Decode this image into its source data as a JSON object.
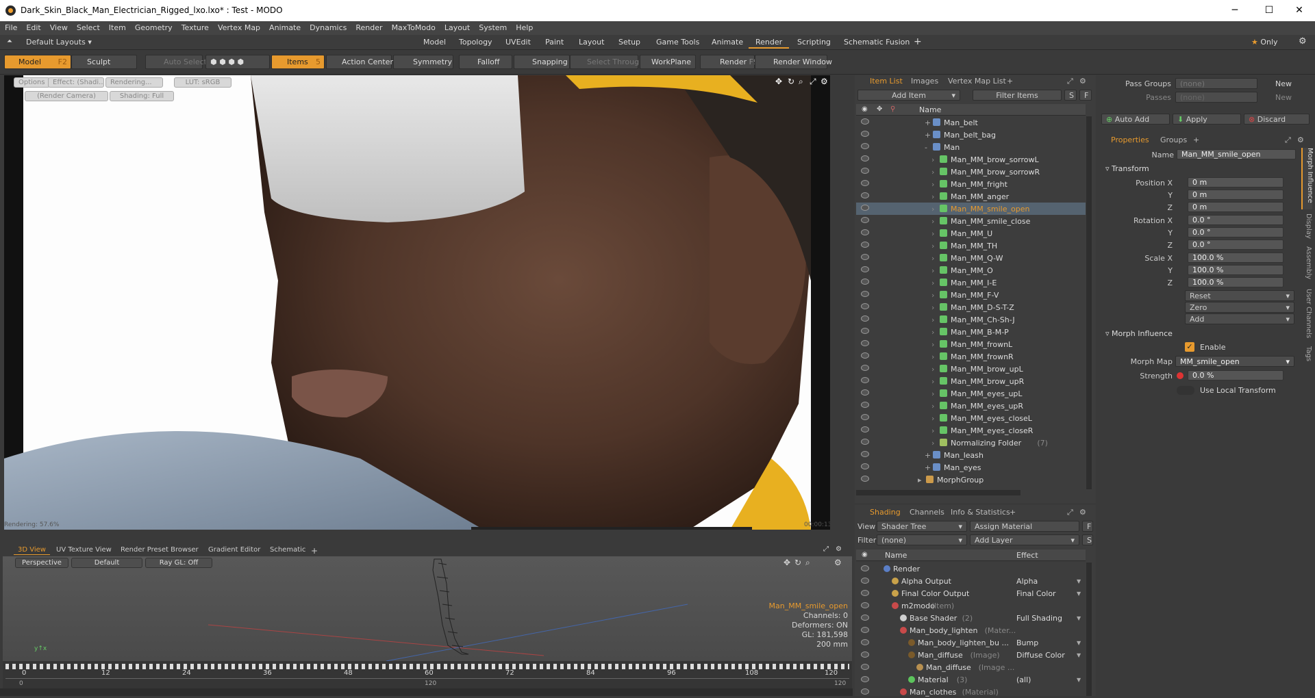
{
  "app": {
    "title": "Dark_Skin_Black_Man_Electrician_Rigged_lxo.lxo* : Test - MODO"
  },
  "menu": [
    "File",
    "Edit",
    "View",
    "Select",
    "Item",
    "Geometry",
    "Texture",
    "Vertex Map",
    "Animate",
    "Dynamics",
    "Render",
    "MaxToModo",
    "Layout",
    "System",
    "Help"
  ],
  "layoutbar": {
    "preset": "Default Layouts",
    "tabs": [
      "Model",
      "Topology",
      "UVEdit",
      "Paint",
      "Layout",
      "Setup",
      "Game Tools",
      "Animate",
      "Render",
      "Scripting",
      "Schematic Fusion"
    ],
    "active": "Render",
    "only": "Only"
  },
  "toolbar": {
    "model": "Model",
    "model_key": "F2",
    "sculpt": "Sculpt",
    "auto_select": "Auto Select",
    "items": "Items",
    "items_key": "5",
    "action_center": "Action Center",
    "symmetry": "Symmetry",
    "falloff": "Falloff",
    "snapping": "Snapping",
    "select_through": "Select Through",
    "workplane": "WorkPlane",
    "render": "Render",
    "render_key": "F9",
    "render_window": "Render Window"
  },
  "viewport": {
    "options": "Options",
    "effect": "Effect: (Shadi...",
    "rendering": "Rendering...",
    "lut": "LUT: sRGB",
    "camera": "(Render Camera)",
    "shading": "Shading: Full",
    "render_status": "Rendering: 57.6%",
    "time": "00:00:13"
  },
  "bottom_tabs": [
    "3D View",
    "UV Texture View",
    "Render Preset Browser",
    "Gradient Editor",
    "Schematic"
  ],
  "view3d": {
    "perspective": "Perspective",
    "default": "Default",
    "raygl": "Ray GL: Off",
    "item": "Man_MM_smile_open",
    "channels": "Channels: 0",
    "deformers": "Deformers: ON",
    "gl": "GL: 181,598",
    "scale": "200 mm"
  },
  "timeline": {
    "ticks": [
      "0",
      "12",
      "24",
      "36",
      "48",
      "60",
      "72",
      "84",
      "96",
      "108",
      "120"
    ],
    "lower": [
      "0",
      "120",
      "120"
    ]
  },
  "item_list": {
    "tabs": [
      "Item List",
      "Images",
      "Vertex Map List"
    ],
    "add_item": "Add Item",
    "filter": "Filter Items",
    "col_name": "Name",
    "rows": [
      {
        "label": "Man_belt",
        "indent": 2,
        "kind": "mesh",
        "exp": "+"
      },
      {
        "label": "Man_belt_bag",
        "indent": 2,
        "kind": "mesh",
        "exp": "+"
      },
      {
        "label": "Man",
        "indent": 2,
        "kind": "mesh",
        "exp": "-"
      },
      {
        "label": "Man_MM_brow_sorrowL",
        "indent": 3,
        "kind": "morph"
      },
      {
        "label": "Man_MM_brow_sorrowR",
        "indent": 3,
        "kind": "morph"
      },
      {
        "label": "Man_MM_fright",
        "indent": 3,
        "kind": "morph"
      },
      {
        "label": "Man_MM_anger",
        "indent": 3,
        "kind": "morph"
      },
      {
        "label": "Man_MM_smile_open",
        "indent": 3,
        "kind": "morph",
        "selected": true
      },
      {
        "label": "Man_MM_smile_close",
        "indent": 3,
        "kind": "morph"
      },
      {
        "label": "Man_MM_U",
        "indent": 3,
        "kind": "morph"
      },
      {
        "label": "Man_MM_TH",
        "indent": 3,
        "kind": "morph"
      },
      {
        "label": "Man_MM_Q-W",
        "indent": 3,
        "kind": "morph"
      },
      {
        "label": "Man_MM_O",
        "indent": 3,
        "kind": "morph"
      },
      {
        "label": "Man_MM_I-E",
        "indent": 3,
        "kind": "morph"
      },
      {
        "label": "Man_MM_F-V",
        "indent": 3,
        "kind": "morph"
      },
      {
        "label": "Man_MM_D-S-T-Z",
        "indent": 3,
        "kind": "morph"
      },
      {
        "label": "Man_MM_Ch-Sh-J",
        "indent": 3,
        "kind": "morph"
      },
      {
        "label": "Man_MM_B-M-P",
        "indent": 3,
        "kind": "morph"
      },
      {
        "label": "Man_MM_frownL",
        "indent": 3,
        "kind": "morph"
      },
      {
        "label": "Man_MM_frownR",
        "indent": 3,
        "kind": "morph"
      },
      {
        "label": "Man_MM_brow_upL",
        "indent": 3,
        "kind": "morph"
      },
      {
        "label": "Man_MM_brow_upR",
        "indent": 3,
        "kind": "morph"
      },
      {
        "label": "Man_MM_eyes_upL",
        "indent": 3,
        "kind": "morph"
      },
      {
        "label": "Man_MM_eyes_upR",
        "indent": 3,
        "kind": "morph"
      },
      {
        "label": "Man_MM_eyes_closeL",
        "indent": 3,
        "kind": "morph"
      },
      {
        "label": "Man_MM_eyes_closeR",
        "indent": 3,
        "kind": "morph"
      },
      {
        "label": "Normalizing Folder",
        "extra": "(7)",
        "indent": 3,
        "kind": "folder"
      },
      {
        "label": "Man_leash",
        "indent": 2,
        "kind": "mesh",
        "exp": "+"
      },
      {
        "label": "Man_eyes",
        "indent": 2,
        "kind": "mesh",
        "exp": "+"
      },
      {
        "label": "MorphGroup",
        "indent": 1,
        "kind": "group",
        "exp": "▸"
      }
    ]
  },
  "props": {
    "pass_groups": "Pass Groups",
    "passes": "Passes",
    "none": "(none)",
    "new": "New",
    "auto_add": "Auto Add",
    "apply": "Apply",
    "discard": "Discard",
    "tabs": [
      "Properties",
      "Groups"
    ],
    "name_label": "Name",
    "name": "Man_MM_smile_open",
    "transform": "Transform",
    "position_x": "Position X",
    "rotation_x": "Rotation X",
    "scale_x": "Scale X",
    "y": "Y",
    "z": "Z",
    "pos": [
      "0 m",
      "0 m",
      "0 m"
    ],
    "rot": [
      "0.0 °",
      "0.0 °",
      "0.0 °"
    ],
    "scale": [
      "100.0 %",
      "100.0 %",
      "100.0 %"
    ],
    "reset": "Reset",
    "zero": "Zero",
    "add": "Add",
    "morph_influence": "Morph Influence",
    "enable": "Enable",
    "morph_map_label": "Morph Map",
    "morph_map": "MM_smile_open",
    "strength_label": "Strength",
    "strength": "0.0 %",
    "use_local": "Use Local Transform",
    "side_tabs": [
      "Morph Influence",
      "Display",
      "Assembly",
      "User Channels",
      "Tags"
    ]
  },
  "shading": {
    "tabs": [
      "Shading",
      "Channels",
      "Info & Statistics"
    ],
    "view_label": "View",
    "view": "Shader Tree",
    "assign": "Assign Material",
    "filter_label": "Filter",
    "filter": "(none)",
    "add_layer": "Add Layer",
    "col_name": "Name",
    "col_effect": "Effect",
    "rows": [
      {
        "label": "Render",
        "indent": 0,
        "effect": "",
        "icon": "#5b7fc7"
      },
      {
        "label": "Alpha Output",
        "indent": 1,
        "effect": "Alpha",
        "icon": "#c9a24a"
      },
      {
        "label": "Final Color Output",
        "indent": 1,
        "effect": "Final Color",
        "icon": "#c9a24a"
      },
      {
        "label": "m2modo",
        "extra": "(Item)",
        "indent": 1,
        "effect": "",
        "icon": "#c84a4a"
      },
      {
        "label": "Base Shader",
        "extra": "(2)",
        "indent": 2,
        "effect": "Full Shading",
        "icon": "#cfcfcf"
      },
      {
        "label": "Man_body_lighten",
        "extra": "(Mater...",
        "indent": 2,
        "effect": "",
        "icon": "#c84a4a"
      },
      {
        "label": "Man_body_lighten_bu ...",
        "indent": 3,
        "effect": "Bump",
        "icon": "#7a5a2a"
      },
      {
        "label": "Man_diffuse",
        "extra": "(Image)",
        "indent": 3,
        "effect": "Diffuse Color",
        "icon": "#7a5a2a"
      },
      {
        "label": "Man_diffuse",
        "extra": "(Image ...",
        "indent": 4,
        "effect": "",
        "icon": "#b89050"
      },
      {
        "label": "Material",
        "extra": "(3)",
        "indent": 3,
        "effect": "(all)",
        "icon": "#5cc45c"
      },
      {
        "label": "Man_clothes",
        "extra": "(Material)",
        "indent": 2,
        "effect": "",
        "icon": "#c84a4a"
      }
    ]
  },
  "colors": {
    "accent": "#e79a2e",
    "selected_row": "#556370",
    "panel": "#3d3d3d"
  }
}
